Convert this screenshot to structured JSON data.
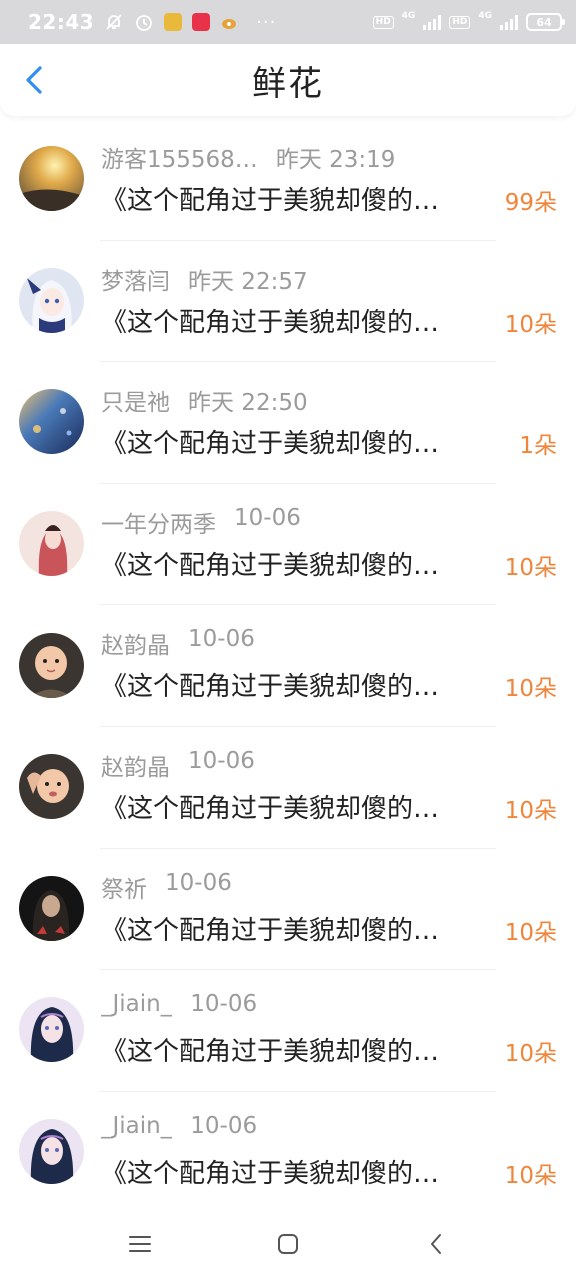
{
  "status_bar": {
    "time": "22:43",
    "net_label": "4G",
    "hd_label": "HD",
    "battery": "64",
    "icons": [
      "mute-bell-icon",
      "alarm-icon",
      "app-icon",
      "app-icon",
      "weibo-icon"
    ],
    "more": "···"
  },
  "header": {
    "title": "鲜花",
    "back_icon": "chevron-left-icon"
  },
  "list": [
    {
      "name": "游客155568…",
      "time": "昨天 23:19",
      "text": "《这个配角过于美貌却傻的…",
      "amount": "99朵"
    },
    {
      "name": "梦落闫",
      "time": "昨天 22:57",
      "text": "《这个配角过于美貌却傻的…",
      "amount": "10朵"
    },
    {
      "name": "只是祂",
      "time": "昨天 22:50",
      "text": "《这个配角过于美貌却傻的…",
      "amount": "1朵"
    },
    {
      "name": "一年分两季",
      "time": "10-06",
      "text": "《这个配角过于美貌却傻的…",
      "amount": "10朵"
    },
    {
      "name": "赵韵晶",
      "time": "10-06",
      "text": "《这个配角过于美貌却傻的…",
      "amount": "10朵"
    },
    {
      "name": "赵韵晶",
      "time": "10-06",
      "text": "《这个配角过于美貌却傻的…",
      "amount": "10朵"
    },
    {
      "name": "祭祈",
      "time": "10-06",
      "text": "《这个配角过于美貌却傻的…",
      "amount": "10朵"
    },
    {
      "name": "_Jiain_",
      "time": "10-06",
      "text": "《这个配角过于美貌却傻的…",
      "amount": "10朵"
    },
    {
      "name": "_Jiain_",
      "time": "10-06",
      "text": "《这个配角过于美貌却傻的…",
      "amount": "10朵"
    }
  ],
  "navbar": {
    "icons": [
      "menu-icon",
      "home-icon",
      "back-icon"
    ]
  },
  "colors": {
    "accent": "#2f8ff0",
    "amount": "#f0853a",
    "meta": "#9b9b9b",
    "text": "#222222"
  }
}
